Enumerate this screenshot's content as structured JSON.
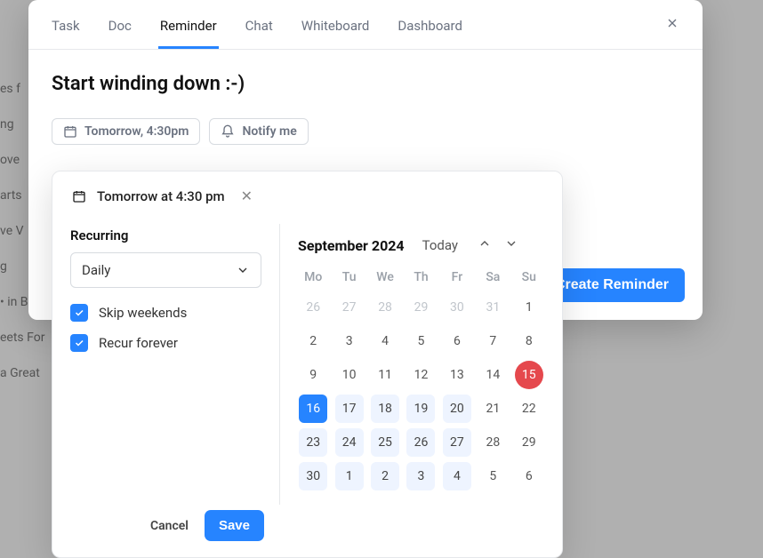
{
  "background": {
    "lines": [
      "es f",
      "ng",
      "ove",
      "arts",
      "ve V",
      "g",
      "• in Blo",
      "eets For",
      "a Great"
    ]
  },
  "tabs": {
    "items": [
      {
        "label": "Task",
        "active": false
      },
      {
        "label": "Doc",
        "active": false
      },
      {
        "label": "Reminder",
        "active": true
      },
      {
        "label": "Chat",
        "active": false
      },
      {
        "label": "Whiteboard",
        "active": false
      },
      {
        "label": "Dashboard",
        "active": false
      }
    ]
  },
  "reminder": {
    "title": "Start winding down :-)",
    "chips": {
      "date": "Tomorrow, 4:30pm",
      "notify": "Notify me"
    },
    "create_label": "Create Reminder"
  },
  "popover": {
    "header": "Tomorrow at 4:30 pm",
    "recurring": {
      "label": "Recurring",
      "select_value": "Daily",
      "skip_weekends_label": "Skip weekends",
      "skip_weekends_checked": true,
      "recur_forever_label": "Recur forever",
      "recur_forever_checked": true
    },
    "calendar": {
      "title": "September 2024",
      "today_label": "Today",
      "dow": [
        "Mo",
        "Tu",
        "We",
        "Th",
        "Fr",
        "Sa",
        "Su"
      ],
      "weeks": [
        [
          {
            "d": "26",
            "m": true
          },
          {
            "d": "27",
            "m": true
          },
          {
            "d": "28",
            "m": true
          },
          {
            "d": "29",
            "m": true
          },
          {
            "d": "30",
            "m": true
          },
          {
            "d": "31",
            "m": true
          },
          {
            "d": "1"
          }
        ],
        [
          {
            "d": "2"
          },
          {
            "d": "3"
          },
          {
            "d": "4"
          },
          {
            "d": "5"
          },
          {
            "d": "6"
          },
          {
            "d": "7"
          },
          {
            "d": "8"
          }
        ],
        [
          {
            "d": "9"
          },
          {
            "d": "10"
          },
          {
            "d": "11"
          },
          {
            "d": "12"
          },
          {
            "d": "13"
          },
          {
            "d": "14"
          },
          {
            "d": "15",
            "today": true
          }
        ],
        [
          {
            "d": "16",
            "sel": true
          },
          {
            "d": "17",
            "r": true
          },
          {
            "d": "18",
            "r": true
          },
          {
            "d": "19",
            "r": true
          },
          {
            "d": "20",
            "r": true
          },
          {
            "d": "21"
          },
          {
            "d": "22"
          }
        ],
        [
          {
            "d": "23",
            "r": true
          },
          {
            "d": "24",
            "r": true
          },
          {
            "d": "25",
            "r": true
          },
          {
            "d": "26",
            "r": true
          },
          {
            "d": "27",
            "r": true
          },
          {
            "d": "28"
          },
          {
            "d": "29"
          }
        ],
        [
          {
            "d": "30",
            "r": true
          },
          {
            "d": "1",
            "r": true
          },
          {
            "d": "2",
            "r": true
          },
          {
            "d": "3",
            "r": true
          },
          {
            "d": "4",
            "r": true
          },
          {
            "d": "5"
          },
          {
            "d": "6"
          }
        ]
      ]
    },
    "footer": {
      "cancel": "Cancel",
      "save": "Save"
    }
  }
}
